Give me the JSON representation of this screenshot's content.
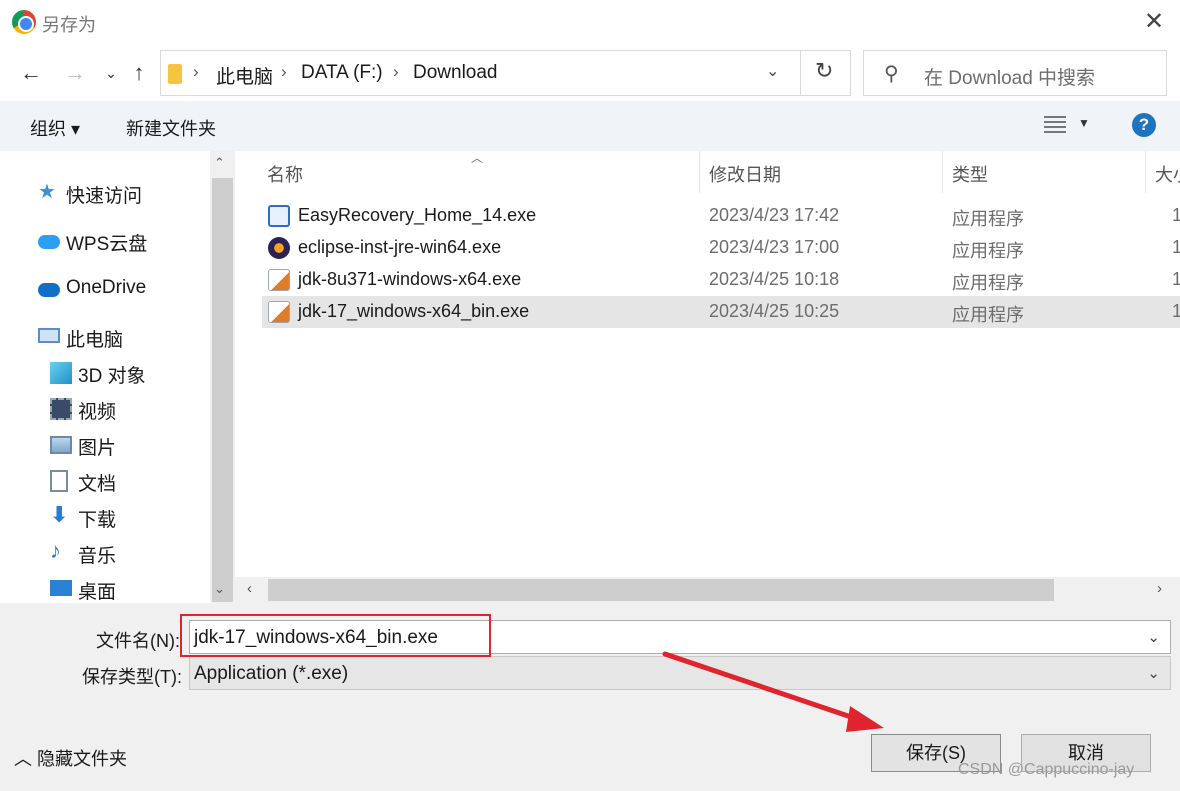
{
  "window": {
    "title": "另存为"
  },
  "address": {
    "crumbs": [
      "此电脑",
      "DATA (F:)",
      "Download"
    ],
    "search_placeholder": "在 Download 中搜索"
  },
  "toolbar": {
    "organize": "组织 ▾",
    "new_folder": "新建文件夹",
    "help": "?"
  },
  "nav": {
    "quick_access": "快速访问",
    "wps": "WPS云盘",
    "onedrive": "OneDrive",
    "this_pc": "此电脑",
    "objects3d": "3D 对象",
    "videos": "视频",
    "pictures": "图片",
    "documents": "文档",
    "downloads": "下载",
    "music": "音乐",
    "desktop": "桌面"
  },
  "list": {
    "columns": {
      "name": "名称",
      "modified": "修改日期",
      "type": "类型",
      "size": "大小"
    },
    "files": [
      {
        "name": "EasyRecovery_Home_14.exe",
        "modified": "2023/4/23 17:42",
        "type": "应用程序",
        "size": "1",
        "icon": "easyrecovery-icon"
      },
      {
        "name": "eclipse-inst-jre-win64.exe",
        "modified": "2023/4/23 17:00",
        "type": "应用程序",
        "size": "1",
        "icon": "eclipse-icon"
      },
      {
        "name": "jdk-8u371-windows-x64.exe",
        "modified": "2023/4/25 10:18",
        "type": "应用程序",
        "size": "1",
        "icon": "java-installer-icon"
      },
      {
        "name": "jdk-17_windows-x64_bin.exe",
        "modified": "2023/4/25 10:25",
        "type": "应用程序",
        "size": "1",
        "icon": "java-installer-icon",
        "selected": true
      }
    ]
  },
  "form": {
    "filename_label": "文件名(N):",
    "filename_value": "jdk-17_windows-x64_bin.exe",
    "filetype_label": "保存类型(T):",
    "filetype_value": "Application (*.exe)"
  },
  "buttons": {
    "save": "保存(S)",
    "cancel": "取消",
    "hide_folders": "隐藏文件夹"
  },
  "watermark": "CSDN @Cappuccino-jay",
  "colors": {
    "accent": "#1e73be",
    "annotation_red": "#e0242d",
    "selection": "#e5e5e5"
  }
}
